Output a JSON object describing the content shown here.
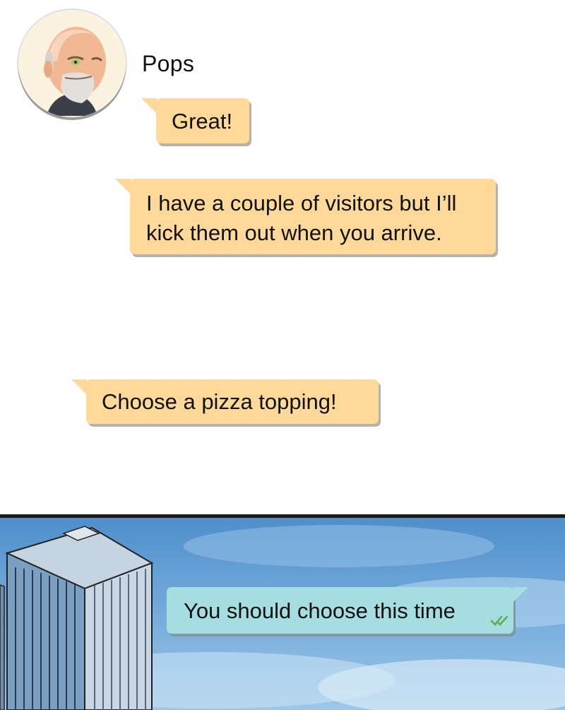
{
  "chat": {
    "sender_name": "Pops",
    "messages": [
      {
        "direction": "incoming",
        "text": "Great!"
      },
      {
        "direction": "incoming",
        "text": "I have a couple of visitors but I’ll kick them out when you arrive."
      },
      {
        "direction": "incoming",
        "text": "Choose a pizza topping!"
      },
      {
        "direction": "outgoing",
        "text": "You should choose this time",
        "status": "read"
      }
    ]
  },
  "colors": {
    "incoming_bubble": "#ffd999",
    "outgoing_bubble": "#a6dde0",
    "read_check": "#5bb04a",
    "sky": "#6aa6d8"
  },
  "icons": {
    "avatar": "bald-bearded-man-portrait",
    "read_receipt": "double-check-icon",
    "scene": "office-tower"
  }
}
